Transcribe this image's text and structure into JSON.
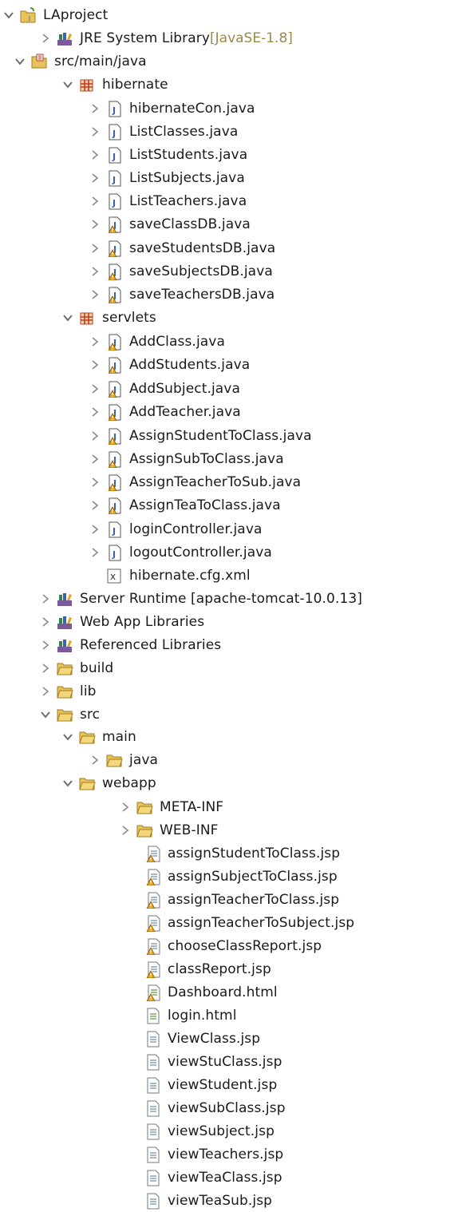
{
  "tree": [
    {
      "label": "LAproject",
      "icon": "project-icon",
      "twisty": "expanded"
    },
    {
      "label": "JRE System Library",
      "decoration": " [JavaSE-1.8]",
      "icon": "library-icon",
      "twisty": "collapsed"
    },
    {
      "label": "src/main/java",
      "icon": "source-folder-icon",
      "twisty": "expanded"
    },
    {
      "label": "hibernate",
      "icon": "package-icon",
      "twisty": "expanded"
    },
    {
      "label": "hibernateCon.java",
      "icon": "java-file-icon",
      "twisty": "collapsed"
    },
    {
      "label": "ListClasses.java",
      "icon": "java-file-icon",
      "twisty": "collapsed"
    },
    {
      "label": "ListStudents.java",
      "icon": "java-file-icon",
      "twisty": "collapsed"
    },
    {
      "label": "ListSubjects.java",
      "icon": "java-file-icon",
      "twisty": "collapsed"
    },
    {
      "label": "ListTeachers.java",
      "icon": "java-file-icon",
      "twisty": "collapsed"
    },
    {
      "label": "saveClassDB.java",
      "icon": "java-file-warning-icon",
      "twisty": "collapsed"
    },
    {
      "label": "saveStudentsDB.java",
      "icon": "java-file-warning-icon",
      "twisty": "collapsed"
    },
    {
      "label": "saveSubjectsDB.java",
      "icon": "java-file-warning-icon",
      "twisty": "collapsed"
    },
    {
      "label": "saveTeachersDB.java",
      "icon": "java-file-warning-icon",
      "twisty": "collapsed"
    },
    {
      "label": "servlets",
      "icon": "package-icon",
      "twisty": "expanded"
    },
    {
      "label": "AddClass.java",
      "icon": "java-file-warning-icon",
      "twisty": "collapsed"
    },
    {
      "label": "AddStudents.java",
      "icon": "java-file-warning-icon",
      "twisty": "collapsed"
    },
    {
      "label": "AddSubject.java",
      "icon": "java-file-warning-icon",
      "twisty": "collapsed"
    },
    {
      "label": "AddTeacher.java",
      "icon": "java-file-warning-icon",
      "twisty": "collapsed"
    },
    {
      "label": "AssignStudentToClass.java",
      "icon": "java-file-warning-icon",
      "twisty": "collapsed"
    },
    {
      "label": "AssignSubToClass.java",
      "icon": "java-file-warning-icon",
      "twisty": "collapsed"
    },
    {
      "label": "AssignTeacherToSub.java",
      "icon": "java-file-warning-icon",
      "twisty": "collapsed"
    },
    {
      "label": "AssignTeaToClass.java",
      "icon": "java-file-warning-icon",
      "twisty": "collapsed"
    },
    {
      "label": "loginController.java",
      "icon": "java-file-icon",
      "twisty": "collapsed"
    },
    {
      "label": "logoutController.java",
      "icon": "java-file-icon",
      "twisty": "collapsed"
    },
    {
      "label": "hibernate.cfg.xml",
      "icon": "xml-file-icon",
      "twisty": "none"
    },
    {
      "label": "Server Runtime [apache-tomcat-10.0.13]",
      "icon": "library-icon",
      "twisty": "collapsed"
    },
    {
      "label": "Web App Libraries",
      "icon": "library-icon",
      "twisty": "collapsed"
    },
    {
      "label": "Referenced Libraries",
      "icon": "library-icon",
      "twisty": "collapsed"
    },
    {
      "label": "build",
      "icon": "folder-icon",
      "twisty": "collapsed"
    },
    {
      "label": "lib",
      "icon": "folder-icon",
      "twisty": "collapsed"
    },
    {
      "label": "src",
      "icon": "folder-icon",
      "twisty": "expanded"
    },
    {
      "label": "main",
      "icon": "folder-icon",
      "twisty": "expanded"
    },
    {
      "label": "java",
      "icon": "folder-icon",
      "twisty": "collapsed"
    },
    {
      "label": "webapp",
      "icon": "folder-icon",
      "twisty": "expanded"
    },
    {
      "label": "META-INF",
      "icon": "folder-icon",
      "twisty": "collapsed"
    },
    {
      "label": "WEB-INF",
      "icon": "folder-icon",
      "twisty": "collapsed"
    },
    {
      "label": "assignStudentToClass.jsp",
      "icon": "jsp-file-warning-icon",
      "twisty": "none"
    },
    {
      "label": "assignSubjectToClass.jsp",
      "icon": "jsp-file-warning-icon",
      "twisty": "none"
    },
    {
      "label": "assignTeacherToClass.jsp",
      "icon": "jsp-file-warning-icon",
      "twisty": "none"
    },
    {
      "label": "assignTeacherToSubject.jsp",
      "icon": "jsp-file-warning-icon",
      "twisty": "none"
    },
    {
      "label": "chooseClassReport.jsp",
      "icon": "jsp-file-warning-icon",
      "twisty": "none"
    },
    {
      "label": "classReport.jsp",
      "icon": "jsp-file-warning-icon",
      "twisty": "none"
    },
    {
      "label": "Dashboard.html",
      "icon": "html-file-warning-icon",
      "twisty": "none"
    },
    {
      "label": "login.html",
      "icon": "html-file-icon",
      "twisty": "none"
    },
    {
      "label": "ViewClass.jsp",
      "icon": "jsp-file-icon",
      "twisty": "none"
    },
    {
      "label": "viewStuClass.jsp",
      "icon": "jsp-file-icon",
      "twisty": "none"
    },
    {
      "label": "viewStudent.jsp",
      "icon": "jsp-file-icon",
      "twisty": "none"
    },
    {
      "label": "viewSubClass.jsp",
      "icon": "jsp-file-icon",
      "twisty": "none"
    },
    {
      "label": "viewSubject.jsp",
      "icon": "jsp-file-icon",
      "twisty": "none"
    },
    {
      "label": "viewTeachers.jsp",
      "icon": "jsp-file-icon",
      "twisty": "none"
    },
    {
      "label": "viewTeaClass.jsp",
      "icon": "jsp-file-icon",
      "twisty": "none"
    },
    {
      "label": "viewTeaSub.jsp",
      "icon": "jsp-file-icon",
      "twisty": "none"
    }
  ],
  "colors": {
    "text": "#1a1a1a",
    "decoration": "#9a8a4a",
    "twisty": "#6f6f6f",
    "folder": "#e8c25a",
    "package": "#c0392b",
    "java": "#3b63a8",
    "warning": "#e5a21a"
  }
}
